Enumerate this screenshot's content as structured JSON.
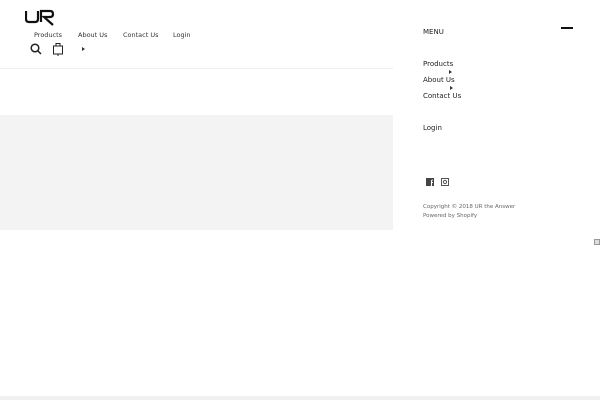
{
  "header": {
    "logo": "UR",
    "nav": [
      "Products",
      "About Us",
      "Contact Us",
      "Login"
    ]
  },
  "sidebar": {
    "menu_label": "MENU",
    "items": [
      "Products",
      "About Us",
      "Contact Us",
      "Login"
    ],
    "social": [
      "facebook-icon",
      "instagram-icon"
    ],
    "copyright": "Copyright © 2018 UR the Answer",
    "powered": "Powered by Shopify"
  }
}
